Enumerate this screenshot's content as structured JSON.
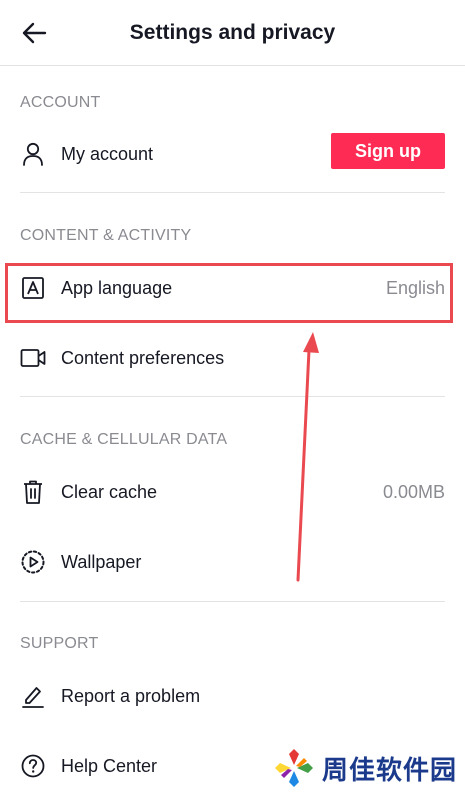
{
  "header": {
    "title": "Settings and privacy"
  },
  "account": {
    "section_title": "ACCOUNT",
    "my_account_label": "My account",
    "signup_label": "Sign up"
  },
  "content_activity": {
    "section_title": "CONTENT & ACTIVITY",
    "app_language_label": "App language",
    "app_language_value": "English",
    "content_preferences_label": "Content preferences"
  },
  "cache": {
    "section_title": "CACHE & CELLULAR DATA",
    "clear_cache_label": "Clear cache",
    "clear_cache_value": "0.00MB",
    "wallpaper_label": "Wallpaper"
  },
  "support": {
    "section_title": "SUPPORT",
    "report_label": "Report a problem",
    "help_label": "Help Center"
  },
  "watermark": {
    "text": "周佳软件园"
  },
  "colors": {
    "accent": "#fe2c55",
    "annotation": "#ea4a4f",
    "muted": "#8a8b91",
    "text": "#161823"
  }
}
